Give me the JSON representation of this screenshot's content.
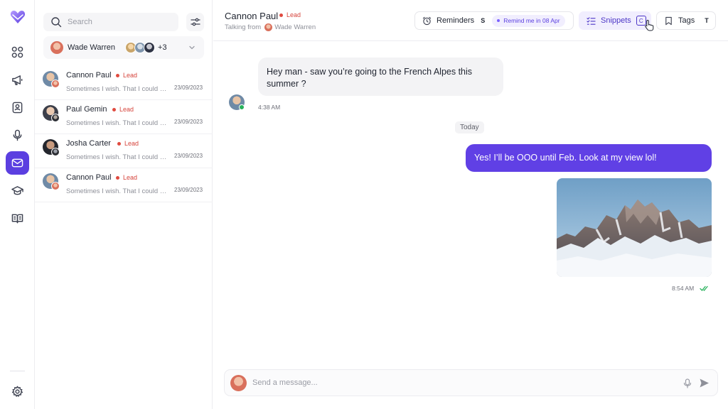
{
  "colors": {
    "accent": "#5b3fe0",
    "outgoing_bubble": "#6040e5",
    "lead": "#e04a3f",
    "online": "#26b15a"
  },
  "rail": {
    "icons": [
      "brand-logo-icon",
      "dashboard-icon",
      "megaphone-icon",
      "contacts-icon",
      "microphone-icon",
      "mail-icon",
      "graduation-cap-icon",
      "book-icon",
      "settings-icon"
    ],
    "active": "mail-icon"
  },
  "sidebar": {
    "search_placeholder": "Search",
    "agent": {
      "name": "Wade Warren",
      "more_count": "+3"
    },
    "conversations": [
      {
        "name": "Cannon Paul",
        "badge": "Lead",
        "preview": "Sometimes I wish. That I could st...",
        "date": "23/09/2023"
      },
      {
        "name": "Paul Gemin",
        "badge": "Lead",
        "preview": "Sometimes I wish. That I could st...",
        "date": "23/09/2023"
      },
      {
        "name": "Josha Carter",
        "badge": "Lead",
        "preview": "Sometimes I wish. That I could st...",
        "date": "23/09/2023"
      },
      {
        "name": "Cannon Paul",
        "badge": "Lead",
        "preview": "Sometimes I wish. That I could st...",
        "date": "23/09/2023"
      }
    ]
  },
  "header": {
    "contact_name": "Cannon Paul",
    "badge": "Lead",
    "talking_from_label": "Talking from",
    "talking_from_agent": "Wade Warren",
    "reminders": {
      "label": "Reminders",
      "shortcut": "S",
      "chip": "Remind me in 08 Apr"
    },
    "snippets": {
      "label": "Snippets",
      "shortcut": "C"
    },
    "tags": {
      "label": "Tags",
      "shortcut": "T"
    }
  },
  "messages": {
    "incoming": {
      "text": "Hey man - saw you’re going to the French Alpes this summer ?",
      "time": "4:38 AM"
    },
    "day_divider": "Today",
    "outgoing": {
      "text": "Yes! I’ll be OOO until Feb. Look at my view lol!",
      "time": "8:54 AM"
    }
  },
  "composer": {
    "placeholder": "Send a message..."
  }
}
